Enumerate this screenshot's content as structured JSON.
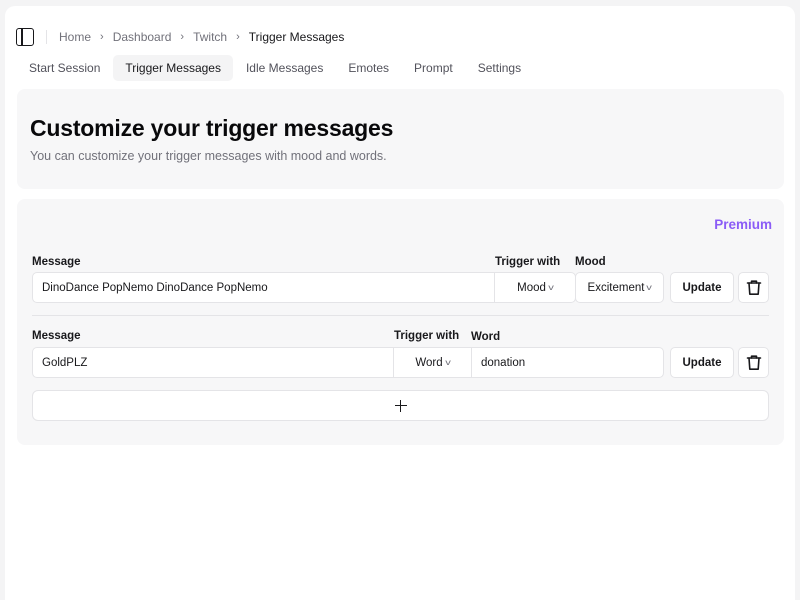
{
  "breadcrumb": {
    "items": [
      "Home",
      "Dashboard",
      "Twitch",
      "Trigger Messages"
    ]
  },
  "tabs": [
    {
      "label": "Start Session",
      "active": false
    },
    {
      "label": "Trigger Messages",
      "active": true
    },
    {
      "label": "Idle Messages",
      "active": false
    },
    {
      "label": "Emotes",
      "active": false
    },
    {
      "label": "Prompt",
      "active": false
    },
    {
      "label": "Settings",
      "active": false
    }
  ],
  "hero": {
    "title": "Customize your trigger messages",
    "subtitle": "You can customize your trigger messages with mood and words."
  },
  "panel": {
    "premium_label": "Premium",
    "accent_color": "#8b5cf6",
    "rows": [
      {
        "message_label": "Message",
        "trigger_label": "Trigger with",
        "extra_label": "Mood",
        "message_value": "DinoDance PopNemo DinoDance PopNemo",
        "trigger_value": "Mood",
        "extra_value": "Excitement",
        "update_label": "Update"
      },
      {
        "message_label": "Message",
        "trigger_label": "Trigger with",
        "extra_label": "Word",
        "message_value": "GoldPLZ",
        "trigger_value": "Word",
        "extra_value": "donation",
        "update_label": "Update"
      }
    ],
    "icons": {
      "delete": "trash-icon",
      "add": "plus-icon",
      "sidebar": "sidebar-toggle-icon",
      "breadcrumb_sep": "chevron-right-icon",
      "select_caret": "chevron-down-icon"
    }
  }
}
